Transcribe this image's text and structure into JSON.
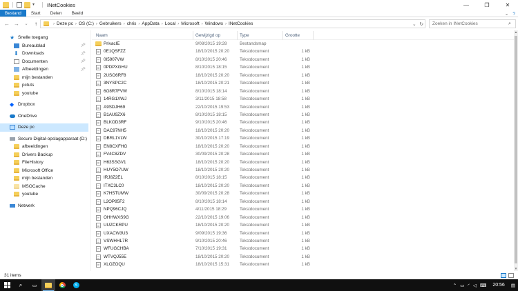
{
  "window": {
    "title": "INetCookies",
    "minimize": "—",
    "maximize": "❐",
    "close": "✕"
  },
  "ribbon": {
    "tabs": [
      "Bestand",
      "Start",
      "Delen",
      "Beeld"
    ]
  },
  "address": {
    "back": "←",
    "forward": "→",
    "up_recent": "⌄",
    "up": "↑",
    "crumbs": [
      "Deze pc",
      "OS (C:)",
      "Gebruikers",
      "chris",
      "AppData",
      "Local",
      "Microsoft",
      "Windows",
      "INetCookies"
    ],
    "search_placeholder": "Zoeken in INetCookies"
  },
  "nav": {
    "quick_access": "Snelle toegang",
    "pinned": [
      "Bureaublad",
      "Downloads",
      "Documenten",
      "Afbeeldingen"
    ],
    "quick_folders": [
      "mijn bestanden",
      "pctuts",
      "youtube"
    ],
    "dropbox": "Dropbox",
    "onedrive": "OneDrive",
    "this_pc": "Deze pc",
    "drive": "Secure Digital-opslagapparaat (D:)",
    "drive_folders": [
      "afbeeldingen",
      "Drivers Backup",
      "FileHistory",
      "Microsoft Office",
      "mijn bestanden",
      "MSOCache",
      "youtube"
    ],
    "network": "Netwerk"
  },
  "columns": {
    "name": "Naam",
    "date": "Gewijzigd op",
    "type": "Type",
    "size": "Grootte"
  },
  "files": [
    {
      "name": "PrivacIE",
      "date": "9/08/2015 19:28",
      "type": "Bestandsmap",
      "size": "",
      "kind": "folder"
    },
    {
      "name": "0E1QSFZZ",
      "date": "18/10/2015 20:20",
      "type": "Tekstdocument",
      "size": "1 kB",
      "kind": "doc"
    },
    {
      "name": "0I5907VW",
      "date": "8/10/2015 20:46",
      "type": "Tekstdocument",
      "size": "1 kB",
      "kind": "doc"
    },
    {
      "name": "0PDPXGHU",
      "date": "8/10/2015 18:15",
      "type": "Tekstdocument",
      "size": "1 kB",
      "kind": "doc"
    },
    {
      "name": "2USO6RF8",
      "date": "18/10/2015 20:20",
      "type": "Tekstdocument",
      "size": "1 kB",
      "kind": "doc"
    },
    {
      "name": "3NYSPC2C",
      "date": "18/10/2015 20:21",
      "type": "Tekstdocument",
      "size": "1 kB",
      "kind": "doc"
    },
    {
      "name": "6O8R7FVW",
      "date": "8/10/2015 18:14",
      "type": "Tekstdocument",
      "size": "1 kB",
      "kind": "doc"
    },
    {
      "name": "14RG1XWJ",
      "date": "3/11/2015 18:58",
      "type": "Tekstdocument",
      "size": "1 kB",
      "kind": "doc"
    },
    {
      "name": "A9SDJH69",
      "date": "22/10/2015 19:53",
      "type": "Tekstdocument",
      "size": "1 kB",
      "kind": "doc"
    },
    {
      "name": "B1AU9ZX6",
      "date": "8/10/2015 18:15",
      "type": "Tekstdocument",
      "size": "1 kB",
      "kind": "doc"
    },
    {
      "name": "BLKOD3RF",
      "date": "9/10/2015 20:46",
      "type": "Tekstdocument",
      "size": "1 kB",
      "kind": "doc"
    },
    {
      "name": "DAC97NH5",
      "date": "18/10/2015 20:20",
      "type": "Tekstdocument",
      "size": "1 kB",
      "kind": "doc"
    },
    {
      "name": "DBRL1VLW",
      "date": "30/10/2015 17:19",
      "type": "Tekstdocument",
      "size": "1 kB",
      "kind": "doc"
    },
    {
      "name": "EN8CXFHG",
      "date": "18/10/2015 20:20",
      "type": "Tekstdocument",
      "size": "1 kB",
      "kind": "doc"
    },
    {
      "name": "FV4C8ZDV",
      "date": "30/09/2015 20:28",
      "type": "Tekstdocument",
      "size": "1 kB",
      "kind": "doc"
    },
    {
      "name": "H63SSGV1",
      "date": "18/10/2015 20:20",
      "type": "Tekstdocument",
      "size": "1 kB",
      "kind": "doc"
    },
    {
      "name": "HUY5O7UW",
      "date": "18/10/2015 20:20",
      "type": "Tekstdocument",
      "size": "1 kB",
      "kind": "doc"
    },
    {
      "name": "IRJ8Z2EL",
      "date": "8/10/2015 18:15",
      "type": "Tekstdocument",
      "size": "1 kB",
      "kind": "doc"
    },
    {
      "name": "ITXC3LC0",
      "date": "18/10/2015 20:20",
      "type": "Tekstdocument",
      "size": "1 kB",
      "kind": "doc"
    },
    {
      "name": "K7HSTUMW",
      "date": "30/09/2015 20:28",
      "type": "Tekstdocument",
      "size": "1 kB",
      "kind": "doc"
    },
    {
      "name": "L2OP85F2",
      "date": "8/10/2015 18:14",
      "type": "Tekstdocument",
      "size": "1 kB",
      "kind": "doc"
    },
    {
      "name": "NPQ96CJQ",
      "date": "4/11/2015 18:29",
      "type": "Tekstdocument",
      "size": "1 kB",
      "kind": "doc"
    },
    {
      "name": "OHHWXS9G",
      "date": "22/10/2015 19:06",
      "type": "Tekstdocument",
      "size": "1 kB",
      "kind": "doc"
    },
    {
      "name": "UUZCKRPU",
      "date": "18/10/2015 20:20",
      "type": "Tekstdocument",
      "size": "1 kB",
      "kind": "doc"
    },
    {
      "name": "UXACW3U3",
      "date": "9/09/2015 19:36",
      "type": "Tekstdocument",
      "size": "1 kB",
      "kind": "doc"
    },
    {
      "name": "VSWHHL7R",
      "date": "9/10/2015 20:46",
      "type": "Tekstdocument",
      "size": "1 kB",
      "kind": "doc"
    },
    {
      "name": "WFUGCHBA",
      "date": "7/10/2015 19:31",
      "type": "Tekstdocument",
      "size": "1 kB",
      "kind": "doc"
    },
    {
      "name": "WTVQJ55E",
      "date": "18/10/2015 20:20",
      "type": "Tekstdocument",
      "size": "1 kB",
      "kind": "doc"
    },
    {
      "name": "XLOZOQU",
      "date": "18/10/2015 15:31",
      "type": "Tekstdocument",
      "size": "1 kB",
      "kind": "doc"
    }
  ],
  "status": {
    "item_count": "31 items"
  },
  "taskbar": {
    "time": "20:56"
  },
  "colors": {
    "accent": "#1979ca",
    "selection": "#cce8ff",
    "folder": "#f5cf5a",
    "taskbar": "#101010"
  }
}
